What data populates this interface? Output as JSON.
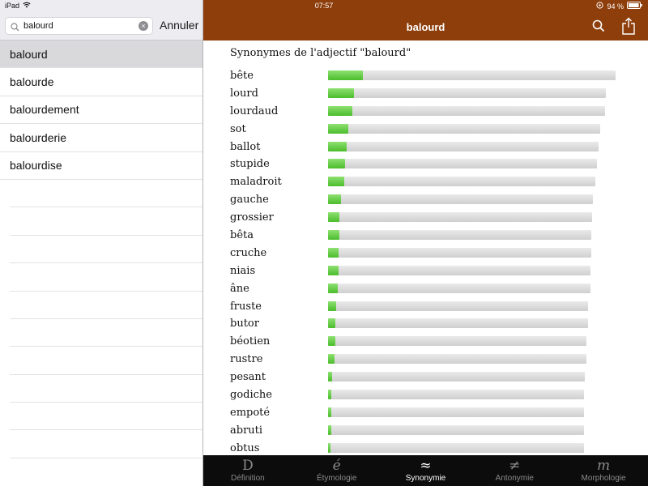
{
  "status": {
    "device": "iPad",
    "time": "07:57",
    "battery": "94 %"
  },
  "search": {
    "value": "balourd",
    "cancel_label": "Annuler"
  },
  "word_list": [
    "balourd",
    "balourde",
    "balourdement",
    "balourderie",
    "balourdise"
  ],
  "selected_index": 0,
  "header": {
    "title": "balourd"
  },
  "synonyms": {
    "heading": "Synonymes de l'adjectif \"balourd\"",
    "items": [
      {
        "word": "bête",
        "track": 1.0,
        "score": 0.12
      },
      {
        "word": "lourd",
        "track": 0.966,
        "score": 0.09
      },
      {
        "word": "lourdaud",
        "track": 0.963,
        "score": 0.085
      },
      {
        "word": "sot",
        "track": 0.946,
        "score": 0.07
      },
      {
        "word": "ballot",
        "track": 0.941,
        "score": 0.065
      },
      {
        "word": "stupide",
        "track": 0.935,
        "score": 0.06
      },
      {
        "word": "maladroit",
        "track": 0.93,
        "score": 0.055
      },
      {
        "word": "gauche",
        "track": 0.921,
        "score": 0.045
      },
      {
        "word": "grossier",
        "track": 0.917,
        "score": 0.04
      },
      {
        "word": "bêta",
        "track": 0.915,
        "score": 0.04
      },
      {
        "word": "cruche",
        "track": 0.915,
        "score": 0.038
      },
      {
        "word": "niais",
        "track": 0.913,
        "score": 0.036
      },
      {
        "word": "âne",
        "track": 0.913,
        "score": 0.035
      },
      {
        "word": "fruste",
        "track": 0.904,
        "score": 0.028
      },
      {
        "word": "butor",
        "track": 0.904,
        "score": 0.026
      },
      {
        "word": "béotien",
        "track": 0.899,
        "score": 0.024
      },
      {
        "word": "rustre",
        "track": 0.899,
        "score": 0.022
      },
      {
        "word": "pesant",
        "track": 0.893,
        "score": 0.014
      },
      {
        "word": "godiche",
        "track": 0.89,
        "score": 0.012
      },
      {
        "word": "empoté",
        "track": 0.89,
        "score": 0.012
      },
      {
        "word": "abruti",
        "track": 0.89,
        "score": 0.01
      },
      {
        "word": "obtus",
        "track": 0.89,
        "score": 0.009
      }
    ]
  },
  "tabs": [
    {
      "glyph": "D",
      "label": "Définition",
      "active": false
    },
    {
      "glyph": "é",
      "label": "Étymologie",
      "active": false
    },
    {
      "glyph": "≈",
      "label": "Synonymie",
      "active": true
    },
    {
      "glyph": "≠",
      "label": "Antonymie",
      "active": false
    },
    {
      "glyph": "m",
      "label": "Morphologie",
      "active": false
    }
  ],
  "colors": {
    "header_bg": "#8d3e0b",
    "bar_fill": "#4bbd2b",
    "tabbar_bg": "#0c0c0c"
  }
}
